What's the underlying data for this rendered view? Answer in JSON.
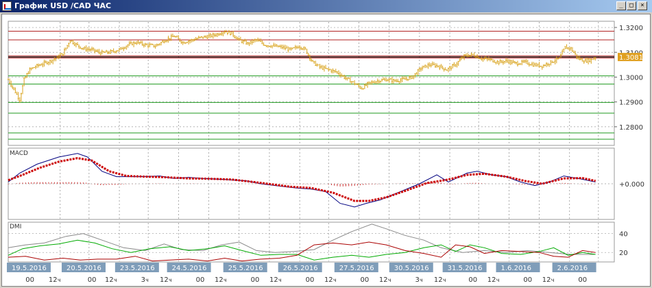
{
  "window": {
    "title": "График USD /CAD  ЧАС",
    "controls": [
      "_",
      "□",
      "×"
    ]
  },
  "chart_data": [
    {
      "type": "candlestick",
      "panel": "price",
      "y_ticks": [
        "1.3200",
        "1.3100",
        "1.3000",
        "1.2900",
        "1.2800"
      ],
      "ylim": [
        1.2725,
        1.3225
      ],
      "current_price_label": "1.3081",
      "current_price": 1.3081,
      "red_levels": [
        1.3185,
        1.315,
        1.3085,
        1.3077
      ],
      "green_levels": [
        1.3005,
        1.2972,
        1.2898,
        1.2855,
        1.2775,
        1.275
      ],
      "close_profile": [
        [
          0,
          1.299
        ],
        [
          4,
          1.295
        ],
        [
          8,
          1.291
        ],
        [
          11,
          1.299
        ],
        [
          15,
          1.303
        ],
        [
          20,
          1.3045
        ],
        [
          27,
          1.306
        ],
        [
          33,
          1.3075
        ],
        [
          38,
          1.3095
        ],
        [
          43,
          1.315
        ],
        [
          46,
          1.3135
        ],
        [
          52,
          1.3115
        ],
        [
          58,
          1.311
        ],
        [
          64,
          1.3098
        ],
        [
          70,
          1.31
        ],
        [
          77,
          1.311
        ],
        [
          83,
          1.313
        ],
        [
          89,
          1.314
        ],
        [
          95,
          1.313
        ],
        [
          102,
          1.3125
        ],
        [
          109,
          1.315
        ],
        [
          115,
          1.3165
        ],
        [
          121,
          1.314
        ],
        [
          128,
          1.315
        ],
        [
          134,
          1.316
        ],
        [
          140,
          1.3165
        ],
        [
          146,
          1.3175
        ],
        [
          150,
          1.3185
        ],
        [
          155,
          1.3175
        ],
        [
          160,
          1.315
        ],
        [
          166,
          1.3135
        ],
        [
          172,
          1.315
        ],
        [
          178,
          1.313
        ],
        [
          184,
          1.3125
        ],
        [
          190,
          1.312
        ],
        [
          196,
          1.311
        ],
        [
          202,
          1.3125
        ],
        [
          206,
          1.311
        ],
        [
          211,
          1.306
        ],
        [
          216,
          1.304
        ],
        [
          222,
          1.303
        ],
        [
          228,
          1.302
        ],
        [
          234,
          1.2995
        ],
        [
          240,
          1.2975
        ],
        [
          245,
          1.2955
        ],
        [
          250,
          1.2975
        ],
        [
          256,
          1.2985
        ],
        [
          262,
          1.299
        ],
        [
          268,
          1.2985
        ],
        [
          274,
          1.299
        ],
        [
          280,
          1.3
        ],
        [
          286,
          1.3035
        ],
        [
          292,
          1.305
        ],
        [
          298,
          1.3045
        ],
        [
          304,
          1.303
        ],
        [
          310,
          1.305
        ],
        [
          316,
          1.3085
        ],
        [
          322,
          1.309
        ],
        [
          328,
          1.3075
        ],
        [
          334,
          1.307
        ],
        [
          340,
          1.306
        ],
        [
          346,
          1.3065
        ],
        [
          352,
          1.3055
        ],
        [
          358,
          1.306
        ],
        [
          364,
          1.305
        ],
        [
          370,
          1.3045
        ],
        [
          376,
          1.306
        ],
        [
          382,
          1.3075
        ],
        [
          386,
          1.312
        ],
        [
          390,
          1.3115
        ],
        [
          395,
          1.3075
        ],
        [
          400,
          1.3065
        ],
        [
          404,
          1.307
        ],
        [
          407,
          1.3081
        ]
      ]
    },
    {
      "type": "line",
      "panel": "macd",
      "label": "MACD",
      "y_ticks": [
        "+0.000"
      ],
      "ylim": [
        -1,
        1
      ],
      "series": [
        {
          "name": "MACD",
          "color": "#000080",
          "values": [
            [
              0,
              0.05
            ],
            [
              8,
              0.3
            ],
            [
              20,
              0.55
            ],
            [
              35,
              0.75
            ],
            [
              48,
              0.85
            ],
            [
              55,
              0.75
            ],
            [
              65,
              0.35
            ],
            [
              75,
              0.2
            ],
            [
              90,
              0.2
            ],
            [
              105,
              0.22
            ],
            [
              115,
              0.15
            ],
            [
              125,
              0.18
            ],
            [
              135,
              0.15
            ],
            [
              150,
              0.12
            ],
            [
              165,
              0.08
            ],
            [
              175,
              0.0
            ],
            [
              185,
              -0.05
            ],
            [
              200,
              -0.12
            ],
            [
              210,
              -0.15
            ],
            [
              220,
              -0.22
            ],
            [
              230,
              -0.55
            ],
            [
              240,
              -0.65
            ],
            [
              248,
              -0.55
            ],
            [
              258,
              -0.45
            ],
            [
              270,
              -0.25
            ],
            [
              285,
              0.0
            ],
            [
              297,
              0.25
            ],
            [
              305,
              0.05
            ],
            [
              318,
              0.3
            ],
            [
              325,
              0.35
            ],
            [
              335,
              0.25
            ],
            [
              345,
              0.2
            ],
            [
              355,
              0.05
            ],
            [
              365,
              -0.05
            ],
            [
              375,
              0.05
            ],
            [
              385,
              0.22
            ],
            [
              395,
              0.15
            ],
            [
              407,
              0.05
            ]
          ]
        },
        {
          "name": "Signal",
          "color": "#cc0000",
          "values": [
            [
              0,
              0.1
            ],
            [
              10,
              0.25
            ],
            [
              22,
              0.45
            ],
            [
              35,
              0.62
            ],
            [
              48,
              0.72
            ],
            [
              58,
              0.65
            ],
            [
              70,
              0.35
            ],
            [
              82,
              0.22
            ],
            [
              95,
              0.2
            ],
            [
              110,
              0.18
            ],
            [
              125,
              0.15
            ],
            [
              140,
              0.14
            ],
            [
              155,
              0.12
            ],
            [
              168,
              0.06
            ],
            [
              180,
              0.0
            ],
            [
              195,
              -0.08
            ],
            [
              210,
              -0.12
            ],
            [
              225,
              -0.25
            ],
            [
              240,
              -0.48
            ],
            [
              250,
              -0.48
            ],
            [
              262,
              -0.38
            ],
            [
              275,
              -0.2
            ],
            [
              290,
              0.02
            ],
            [
              305,
              0.12
            ],
            [
              318,
              0.25
            ],
            [
              330,
              0.28
            ],
            [
              345,
              0.2
            ],
            [
              358,
              0.08
            ],
            [
              370,
              0.0
            ],
            [
              385,
              0.15
            ],
            [
              398,
              0.16
            ],
            [
              407,
              0.08
            ]
          ]
        }
      ]
    },
    {
      "type": "line",
      "panel": "dmi",
      "label": "DMI",
      "y_ticks": [
        "40",
        "20"
      ],
      "ylim": [
        10,
        52
      ],
      "series": [
        {
          "name": "ADX",
          "color": "#888888",
          "values": [
            [
              0,
              25
            ],
            [
              12,
              28
            ],
            [
              25,
              30
            ],
            [
              40,
              37
            ],
            [
              52,
              40
            ],
            [
              65,
              33
            ],
            [
              80,
              25
            ],
            [
              95,
              22
            ],
            [
              108,
              29
            ],
            [
              120,
              23
            ],
            [
              135,
              22
            ],
            [
              148,
              28
            ],
            [
              160,
              31
            ],
            [
              172,
              22
            ],
            [
              185,
              20
            ],
            [
              198,
              21
            ],
            [
              212,
              23
            ],
            [
              225,
              33
            ],
            [
              238,
              42
            ],
            [
              252,
              50
            ],
            [
              262,
              45
            ],
            [
              275,
              38
            ],
            [
              288,
              33
            ],
            [
              300,
              25
            ],
            [
              315,
              20
            ],
            [
              330,
              22
            ],
            [
              345,
              20
            ],
            [
              360,
              22
            ],
            [
              375,
              20
            ],
            [
              390,
              18
            ],
            [
              407,
              18
            ]
          ]
        },
        {
          "name": "+DI",
          "color": "#00aa00",
          "values": [
            [
              0,
              17
            ],
            [
              10,
              24
            ],
            [
              22,
              27
            ],
            [
              35,
              29
            ],
            [
              48,
              33
            ],
            [
              60,
              30
            ],
            [
              72,
              24
            ],
            [
              85,
              20
            ],
            [
              98,
              24
            ],
            [
              112,
              26
            ],
            [
              125,
              22
            ],
            [
              138,
              24
            ],
            [
              150,
              27
            ],
            [
              162,
              22
            ],
            [
              175,
              17
            ],
            [
              188,
              18
            ],
            [
              200,
              18
            ],
            [
              212,
              12
            ],
            [
              225,
              15
            ],
            [
              238,
              17
            ],
            [
              250,
              15
            ],
            [
              262,
              18
            ],
            [
              275,
              20
            ],
            [
              288,
              25
            ],
            [
              300,
              28
            ],
            [
              310,
              21
            ],
            [
              320,
              28
            ],
            [
              330,
              25
            ],
            [
              342,
              19
            ],
            [
              355,
              18
            ],
            [
              368,
              21
            ],
            [
              378,
              25
            ],
            [
              388,
              17
            ],
            [
              398,
              20
            ],
            [
              407,
              18
            ]
          ]
        },
        {
          "name": "-DI",
          "color": "#aa0000",
          "values": [
            [
              0,
              15
            ],
            [
              12,
              16
            ],
            [
              25,
              12
            ],
            [
              38,
              14
            ],
            [
              50,
              12
            ],
            [
              62,
              13
            ],
            [
              75,
              13
            ],
            [
              88,
              16
            ],
            [
              100,
              11
            ],
            [
              112,
              12
            ],
            [
              125,
              13
            ],
            [
              138,
              11
            ],
            [
              150,
              14
            ],
            [
              162,
              11
            ],
            [
              175,
              13
            ],
            [
              188,
              14
            ],
            [
              200,
              17
            ],
            [
              212,
              28
            ],
            [
              225,
              30
            ],
            [
              238,
              28
            ],
            [
              250,
              31
            ],
            [
              262,
              28
            ],
            [
              275,
              22
            ],
            [
              288,
              19
            ],
            [
              300,
              15
            ],
            [
              310,
              28
            ],
            [
              320,
              26
            ],
            [
              330,
              19
            ],
            [
              342,
              22
            ],
            [
              355,
              21
            ],
            [
              368,
              20
            ],
            [
              378,
              16
            ],
            [
              388,
              15
            ],
            [
              398,
              22
            ],
            [
              407,
              20
            ]
          ]
        }
      ]
    }
  ],
  "time_axis": {
    "dates": [
      "19.5.2016",
      "20.5.2016",
      "23.5.2016",
      "24.5.2016",
      "25.5.2016",
      "26.5.2016",
      "27.5.2016",
      "30.5.2016",
      "31.5.2016",
      "1.6.2016",
      "2.6.2016"
    ],
    "hours": [
      "0",
      "12",
      "0",
      "12",
      "3",
      "12",
      "0",
      "12",
      "0",
      "12",
      "0",
      "12",
      "0",
      "12",
      "3",
      "12",
      "0",
      "12",
      "0",
      "12",
      "0"
    ],
    "hour_suffix": "ч"
  }
}
